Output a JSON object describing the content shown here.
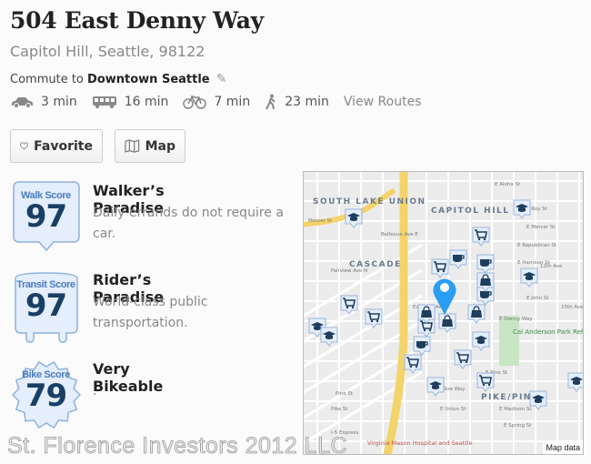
{
  "header": {
    "title": "504 East Denny Way",
    "subtitle": "Capitol Hill, Seattle, 98122"
  },
  "commute": {
    "prefix": "Commute to",
    "destination": "Downtown Seattle",
    "edit_icon": "pencil-icon",
    "modes": [
      {
        "icon": "car-icon",
        "time": "3 min"
      },
      {
        "icon": "bus-icon",
        "time": "16 min"
      },
      {
        "icon": "bike-icon",
        "time": "7 min"
      },
      {
        "icon": "walk-icon",
        "time": "23 min"
      }
    ],
    "view_routes": "View Routes"
  },
  "actions": {
    "favorite": "Favorite",
    "map": "Map"
  },
  "scores": [
    {
      "label": "Walk Score",
      "value": "97",
      "title": "Walker’s Paradise",
      "desc": "Daily errands do not require a car."
    },
    {
      "label": "Transit Score",
      "value": "97",
      "title": "Rider’s Paradise",
      "desc": "World-class public transportation."
    },
    {
      "label": "Bike Score",
      "value": "79",
      "title": "Very Bikeable",
      "desc": "."
    }
  ],
  "colors": {
    "badge_fill": "#e4eefc",
    "badge_stroke": "#8fb0e0",
    "score_text": "#1a3f66",
    "pin": "#2a9df4",
    "marker": "#1f3d5c"
  },
  "map": {
    "areas": [
      "SOUTH LAKE UNION",
      "CAPITOL HILL",
      "CASCADE",
      "PIKE/PINE"
    ],
    "park": "Cal Anderson Park Reflecting Pool",
    "hospital": "Virginia Mason Hospital and Seattle",
    "streets": [
      "Mercer St",
      "E Aloha St",
      "E Roy St",
      "E Mercer St",
      "E Republican St",
      "E Harrison St",
      "E John St",
      "E Denny Way",
      "E Pine St",
      "E Union St",
      "E Madison St",
      "E Spring St",
      "Olive Way",
      "Pine St",
      "Pike St",
      "I-5 Express",
      "Eastlake Ave E",
      "Bellevue Ave E",
      "Fairview Ave N",
      "12th Ave",
      "15th Ave E"
    ],
    "attribution": "Map data"
  },
  "watermark": "St. Florence Investors 2012 LLC"
}
